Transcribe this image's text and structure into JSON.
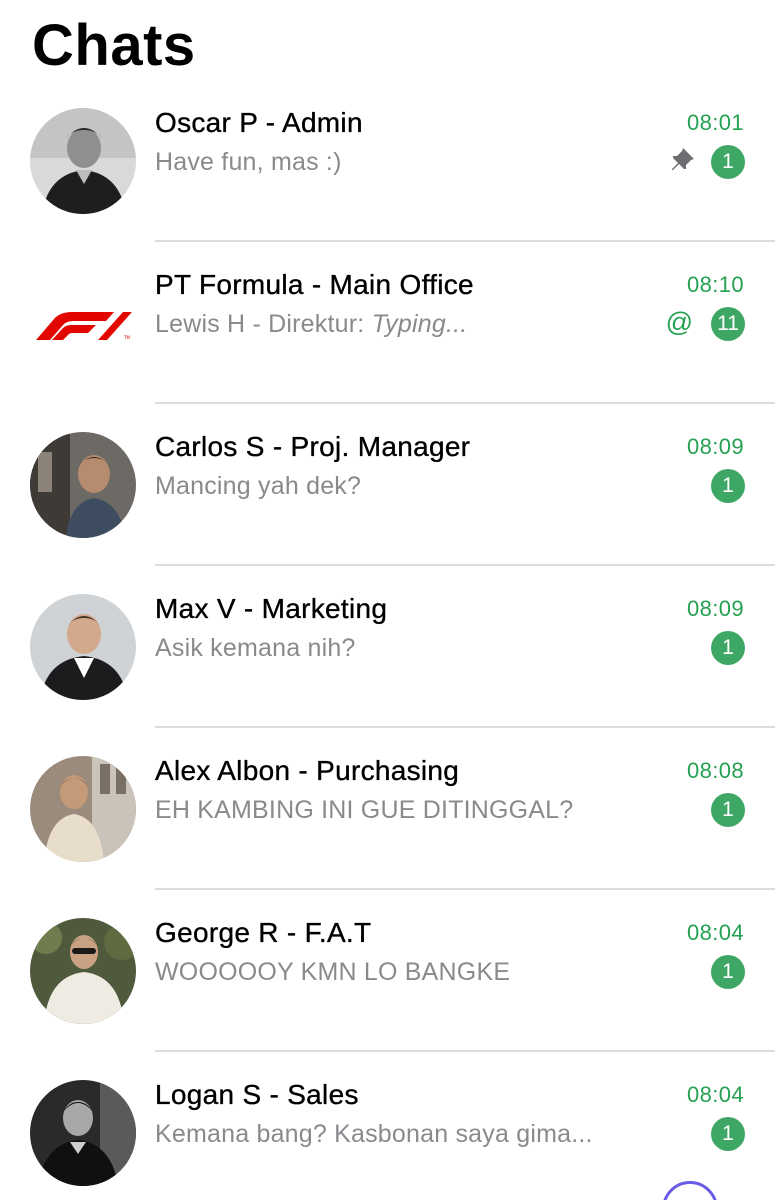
{
  "header": {
    "title": "Chats"
  },
  "colors": {
    "accent_green": "#25a152",
    "badge_green": "#3fa766",
    "secondary_text": "#8a8a8e",
    "separator": "#dcdcdf",
    "f1_red": "#e10600"
  },
  "chats": [
    {
      "name": "Oscar P - Admin",
      "preview": "Have fun, mas :)",
      "time": "08:01",
      "unread": "1",
      "pinned": true,
      "avatar": "photo-avatar"
    },
    {
      "name": "PT Formula - Main Office",
      "preview_sender": "Lewis H - Direktur:",
      "preview_typing": "Typing...",
      "time": "08:10",
      "unread": "11",
      "mention": "@",
      "avatar": "f1-logo"
    },
    {
      "name": "Carlos S - Proj. Manager",
      "preview": "Mancing yah dek?",
      "time": "08:09",
      "unread": "1",
      "avatar": "photo-avatar"
    },
    {
      "name": "Max V - Marketing",
      "preview": "Asik kemana nih?",
      "time": "08:09",
      "unread": "1",
      "avatar": "photo-avatar"
    },
    {
      "name": "Alex Albon - Purchasing",
      "preview": "EH KAMBING INI GUE DITINGGAL?",
      "time": "08:08",
      "unread": "1",
      "avatar": "photo-avatar"
    },
    {
      "name": "George R - F.A.T",
      "preview": "WOOOOOY KMN LO BANGKE",
      "time": "08:04",
      "unread": "1",
      "avatar": "photo-avatar"
    },
    {
      "name": "Logan S - Sales",
      "preview": "Kemana bang? Kasbonan saya gima...",
      "time": "08:04",
      "unread": "1",
      "avatar": "photo-avatar"
    }
  ]
}
